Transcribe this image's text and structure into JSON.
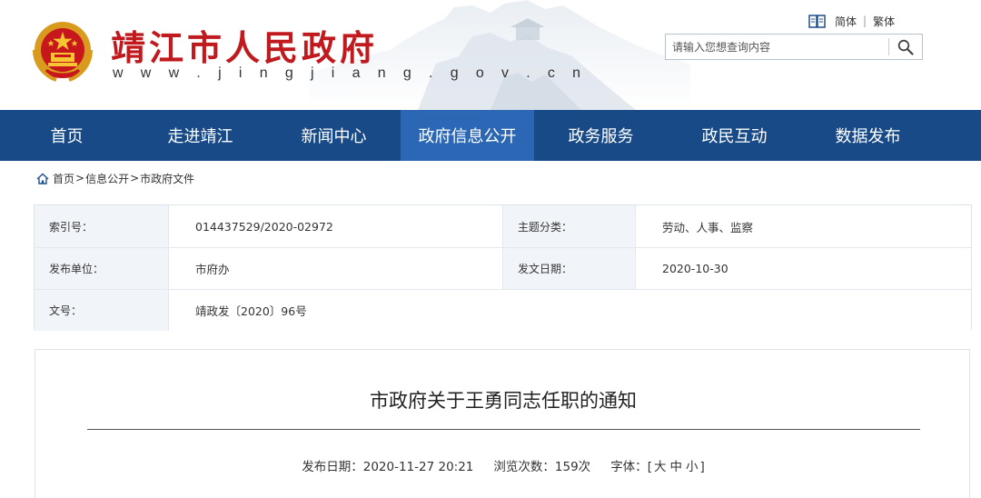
{
  "header": {
    "site_title": "靖江市人民政府",
    "site_url": "w w w . j i n g j i a n g . g o v . c n",
    "accent_color": "#c0191e",
    "emblem_icon": "national-emblem",
    "lang": {
      "icon": "book-icon",
      "simplified": "简体",
      "separator": "|",
      "traditional": "繁体"
    },
    "search": {
      "placeholder": "请输入您想查询内容",
      "icon": "search-icon"
    }
  },
  "nav": {
    "background_color": "#174a86",
    "active_color": "#2b67b4",
    "items": [
      {
        "label": "首页"
      },
      {
        "label": "走进靖江"
      },
      {
        "label": "新闻中心"
      },
      {
        "label": "政府信息公开",
        "active": true
      },
      {
        "label": "政务服务"
      },
      {
        "label": "政民互动"
      },
      {
        "label": "数据发布"
      }
    ]
  },
  "breadcrumb": {
    "icon": "home-icon",
    "items": [
      "首页",
      "信息公开",
      "市政府文件"
    ],
    "separator": ">"
  },
  "info": {
    "index_label": "索引号：",
    "index_value": "014437529/2020-02972",
    "topic_label": "主题分类：",
    "topic_value": "劳动、人事、监察",
    "publisher_label": "发布单位：",
    "publisher_value": "市府办",
    "issue_date_label": "发文日期：",
    "issue_date_value": "2020-10-30",
    "doc_no_label": "文号：",
    "doc_no_value": "靖政发〔2020〕96号"
  },
  "article": {
    "title": "市政府关于王勇同志任职的通知",
    "publish_date": "发布日期：2020-11-27 20:21",
    "views": "浏览次数：159次",
    "font_size_label": "字体：",
    "font_open": "[",
    "font_large": "大",
    "font_medium": "中",
    "font_small": "小",
    "font_close": "]"
  }
}
